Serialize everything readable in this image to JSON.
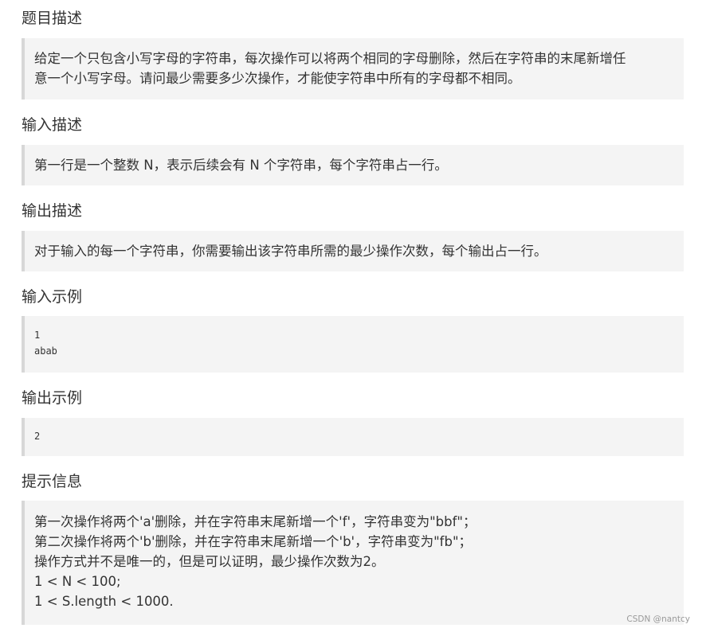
{
  "sections": {
    "description": {
      "title": "题目描述",
      "lines": [
        "给定一个只包含小写字母的字符串，每次操作可以将两个相同的字母删除，然后在字符串的末尾新增任",
        "意一个小写字母。请问最少需要多少次操作，才能使字符串中所有的字母都不相同。"
      ]
    },
    "input": {
      "title": "输入描述",
      "lines": [
        "第一行是一个整数 N，表示后续会有 N 个字符串，每个字符串占一行。"
      ]
    },
    "output": {
      "title": "输出描述",
      "lines": [
        "对于输入的每一个字符串，你需要输出该字符串所需的最少操作次数，每个输出占一行。"
      ]
    },
    "input_example": {
      "title": "输入示例",
      "lines": [
        "1",
        "abab"
      ]
    },
    "output_example": {
      "title": "输出示例",
      "lines": [
        "2"
      ]
    },
    "hint": {
      "title": "提示信息",
      "lines": [
        "第一次操作将两个'a'删除，并在字符串末尾新增一个'f'，字符串变为\"bbf\"；",
        "第二次操作将两个'b'删除，并在字符串末尾新增一个'b'，字符串变为\"fb\"；",
        "操作方式并不是唯一的，但是可以证明，最少操作次数为2。",
        "1 < N < 100;",
        "1 < S.length < 1000."
      ]
    }
  },
  "watermark": "CSDN @nantcy"
}
